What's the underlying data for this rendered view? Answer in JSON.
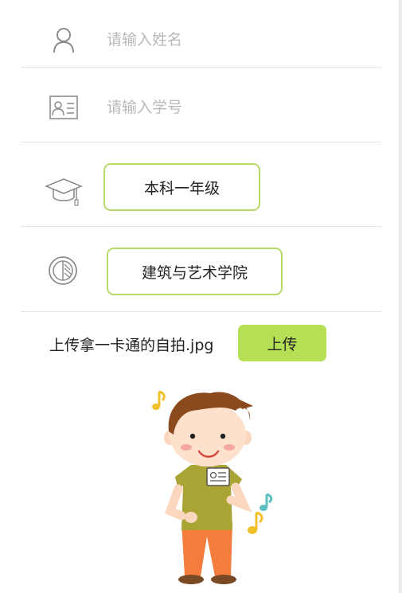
{
  "form": {
    "name_placeholder": "请输入姓名",
    "student_id_placeholder": "请输入学号",
    "grade_value": "本科一年级",
    "college_value": "建筑与艺术学院"
  },
  "upload": {
    "filename": "上传拿一卡通的自拍.jpg",
    "button_label": "上传"
  },
  "colors": {
    "accent": "#b5df55",
    "pill_border": "#b6da6a",
    "divider": "#e3e3e3",
    "placeholder": "#b9b9b9"
  },
  "icons": [
    "person-icon",
    "id-card-icon",
    "graduation-cap-icon",
    "college-icon",
    "music-note-icon"
  ]
}
